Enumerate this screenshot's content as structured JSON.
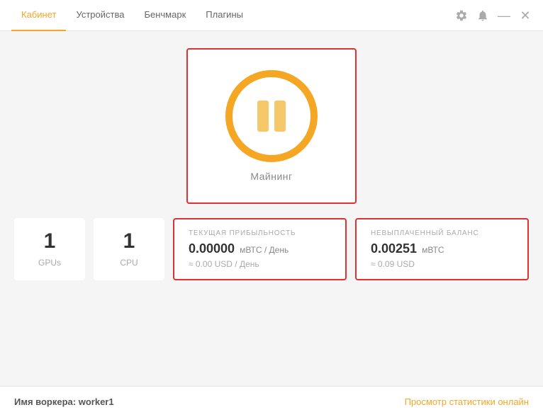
{
  "header": {
    "tabs": [
      {
        "id": "cabinet",
        "label": "Кабинет",
        "active": true
      },
      {
        "id": "devices",
        "label": "Устройства",
        "active": false
      },
      {
        "id": "benchmark",
        "label": "Бенчмарк",
        "active": false
      },
      {
        "id": "plugins",
        "label": "Плагины",
        "active": false
      }
    ]
  },
  "mining": {
    "label": "Майнинг"
  },
  "stats": {
    "gpus_count": "1",
    "gpus_label": "GPUs",
    "cpu_count": "1",
    "cpu_label": "CPU",
    "profitability": {
      "title": "ТЕКУЩАЯ ПРИБЫЛЬНОСТЬ",
      "value": "0.00000",
      "unit": "мВТС / День",
      "sub": "≈ 0.00 USD / День"
    },
    "balance": {
      "title": "НЕВЫПЛАЧЕННЫЙ БАЛАНС",
      "value": "0.00251",
      "unit": "мВТС",
      "sub": "≈ 0.09 USD"
    }
  },
  "footer": {
    "worker_label": "Имя воркера:",
    "worker_name": "worker1",
    "stats_link": "Просмотр статистики онлайн"
  }
}
